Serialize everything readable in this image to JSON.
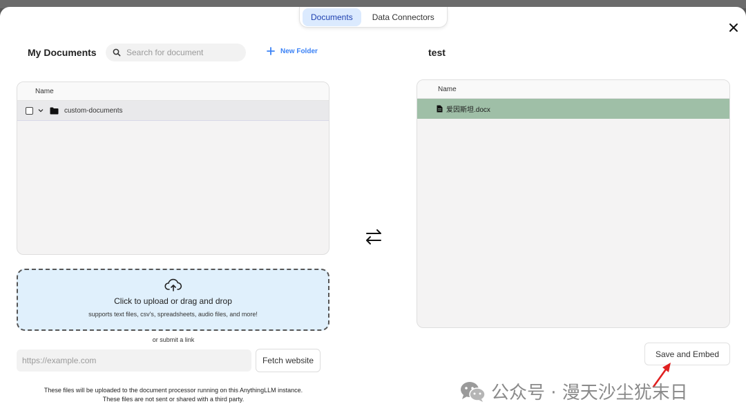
{
  "tabs": [
    {
      "label": "Documents",
      "active": true
    },
    {
      "label": "Data Connectors",
      "active": false
    }
  ],
  "left": {
    "title": "My Documents",
    "search_placeholder": "Search for document",
    "new_folder_label": "New Folder",
    "column_header": "Name",
    "items": [
      {
        "type": "folder",
        "name": "custom-documents",
        "expanded": true,
        "checked": false
      }
    ]
  },
  "right": {
    "title": "test",
    "column_header": "Name",
    "items": [
      {
        "type": "file",
        "name": "爱因斯坦.docx"
      }
    ]
  },
  "upload": {
    "main_text": "Click to upload or drag and drop",
    "sub_text": "supports text files, csv's, spreadsheets, audio files, and more!",
    "or_link": "or submit a link",
    "link_placeholder": "https://example.com",
    "fetch_label": "Fetch website",
    "footnote_line1": "These files will be uploaded to the document processor running on this AnythingLLM instance.",
    "footnote_line2": "These files are not sent or shared with a third party."
  },
  "save_button_label": "Save and Embed",
  "watermark_text": "公众号 · 漫天沙尘犹末日",
  "colors": {
    "accent": "#3b82f6",
    "tab_active_bg": "#dbeafe",
    "file_row_bg": "#9fbfa7",
    "dropzone_bg": "#e0f0fc",
    "annotation_arrow": "#e02020"
  }
}
